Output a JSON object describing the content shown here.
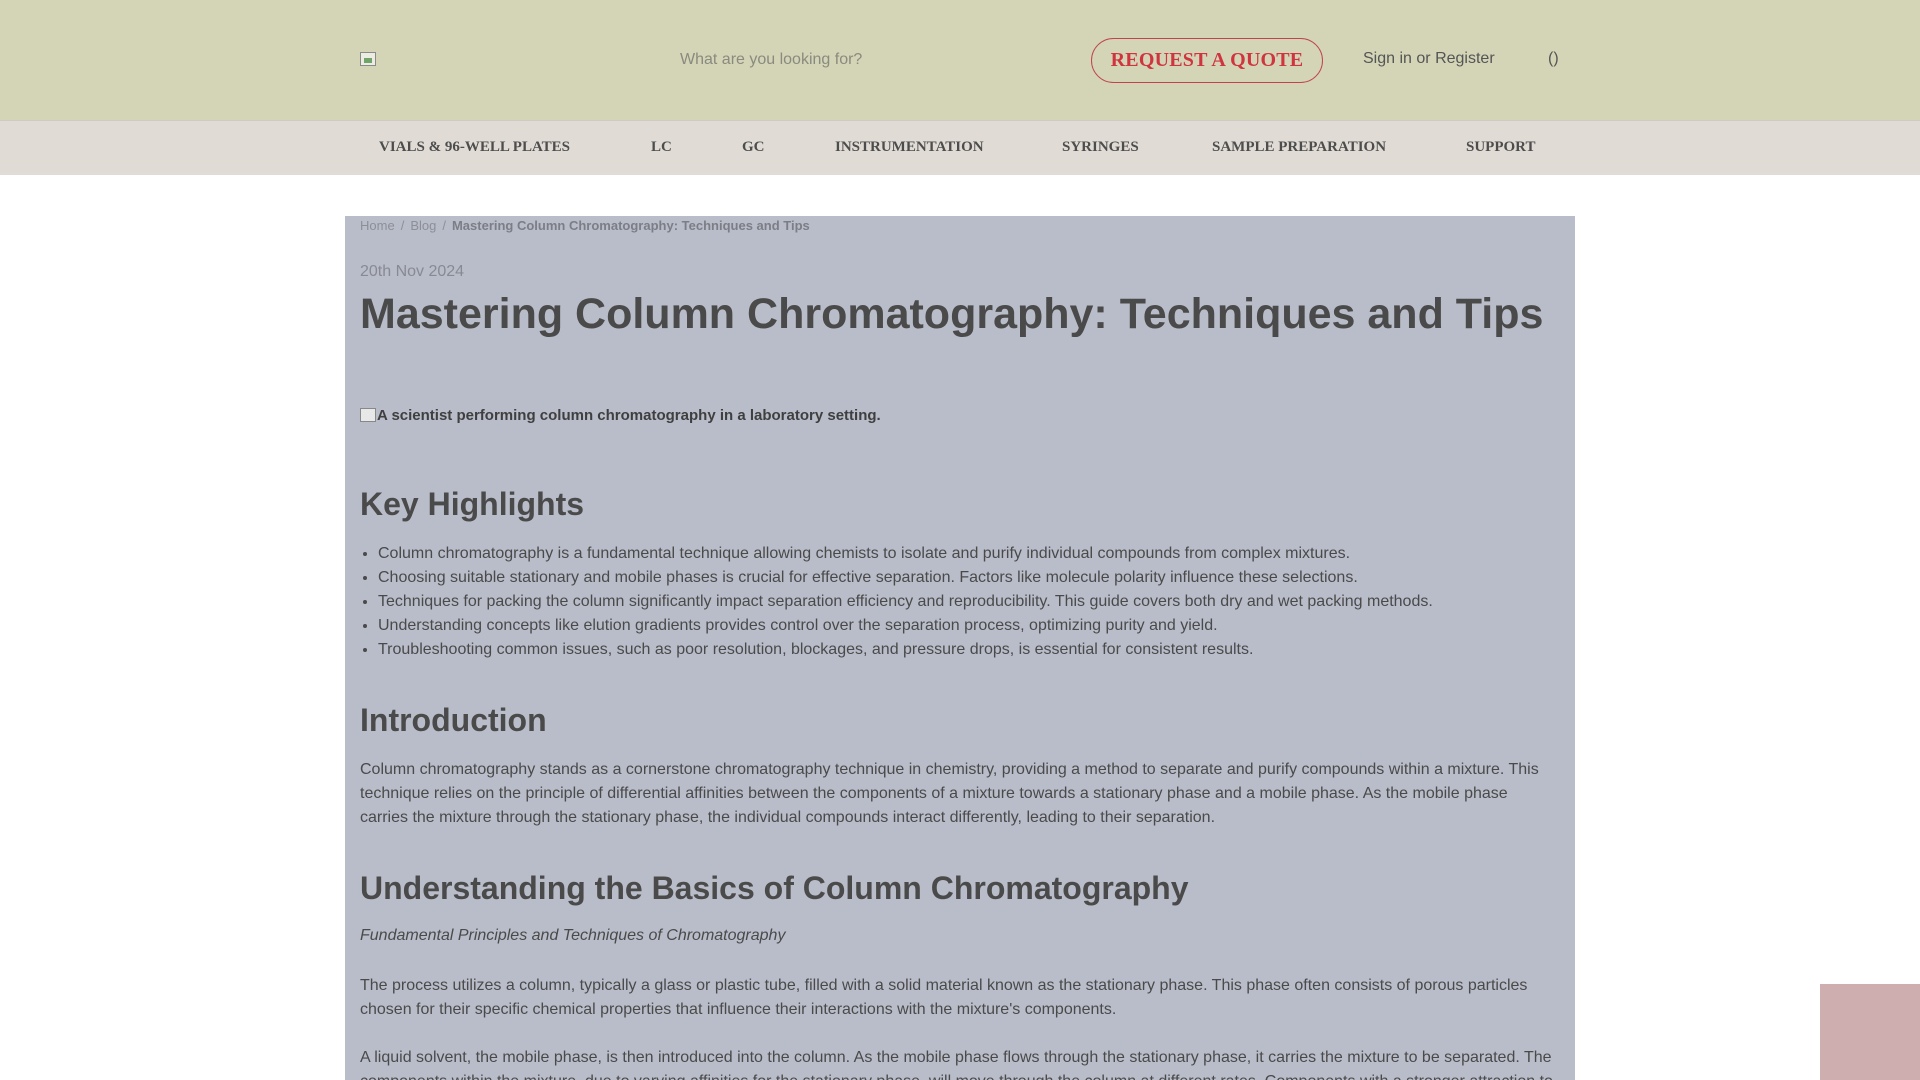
{
  "header": {
    "search_placeholder": "What are you looking for?",
    "quote_button": "REQUEST A QUOTE",
    "sign_in": "Sign in",
    "or": "or",
    "register": "Register",
    "cart": "()"
  },
  "nav": {
    "items": [
      "VIALS & 96-WELL PLATES",
      "LC",
      "GC",
      "INSTRUMENTATION",
      "SYRINGES",
      "SAMPLE PREPARATION",
      "SUPPORT"
    ]
  },
  "breadcrumb": {
    "home": "Home",
    "blog": "Blog",
    "current": "Mastering Column Chromatography: Techniques and Tips",
    "separator": "/"
  },
  "article": {
    "date": "20th Nov 2024",
    "title": "Mastering Column Chromatography: Techniques and Tips",
    "hero_alt": "A scientist performing column chromatography in a laboratory setting.",
    "highlights_heading": "Key Highlights",
    "highlights": [
      "Column chromatography is a fundamental technique allowing chemists to isolate and purify individual compounds from complex mixtures.",
      "Choosing suitable stationary and mobile phases is crucial for effective separation. Factors like molecule polarity influence these selections.",
      "Techniques for packing the column significantly impact separation efficiency and reproducibility. This guide covers both dry and wet packing methods.",
      "Understanding concepts like elution gradients provides control over the separation process, optimizing purity and yield.",
      "Troubleshooting common issues, such as poor resolution, blockages, and pressure drops, is essential for consistent results."
    ],
    "intro_heading": "Introduction",
    "intro_text": "Column chromatography stands as a cornerstone chromatography technique in chemistry, providing a method to separate and purify compounds within a mixture. This technique relies on the principle of differential affinities between the components of a mixture towards a stationary phase and a mobile phase. As the mobile phase carries the mixture through the stationary phase, the individual compounds interact differently, leading to their separation.",
    "basics_heading": "Understanding the Basics of Column Chromatography",
    "basics_subtitle": "Fundamental Principles and Techniques of Chromatography",
    "basics_p1": "The process utilizes a column, typically a glass or plastic tube, filled with a solid material known as the stationary phase. This phase often consists of porous particles chosen for their specific chemical properties that influence their interactions with the mixture's components.",
    "basics_p2": "A liquid solvent, the mobile phase, is then introduced into the column. As the mobile phase flows through the stationary phase, it carries the mixture to be separated. The components within the mixture, due to varying affinities for the stationary phase, will move through the column at different rates. Components with a stronger attraction to"
  },
  "colors": {
    "header_bg": "#d4d5b7",
    "nav_bg": "#e0dcd5",
    "content_bg": "#b9bdc9",
    "accent_red": "#d0343f",
    "widget": "#cfaeb0"
  }
}
